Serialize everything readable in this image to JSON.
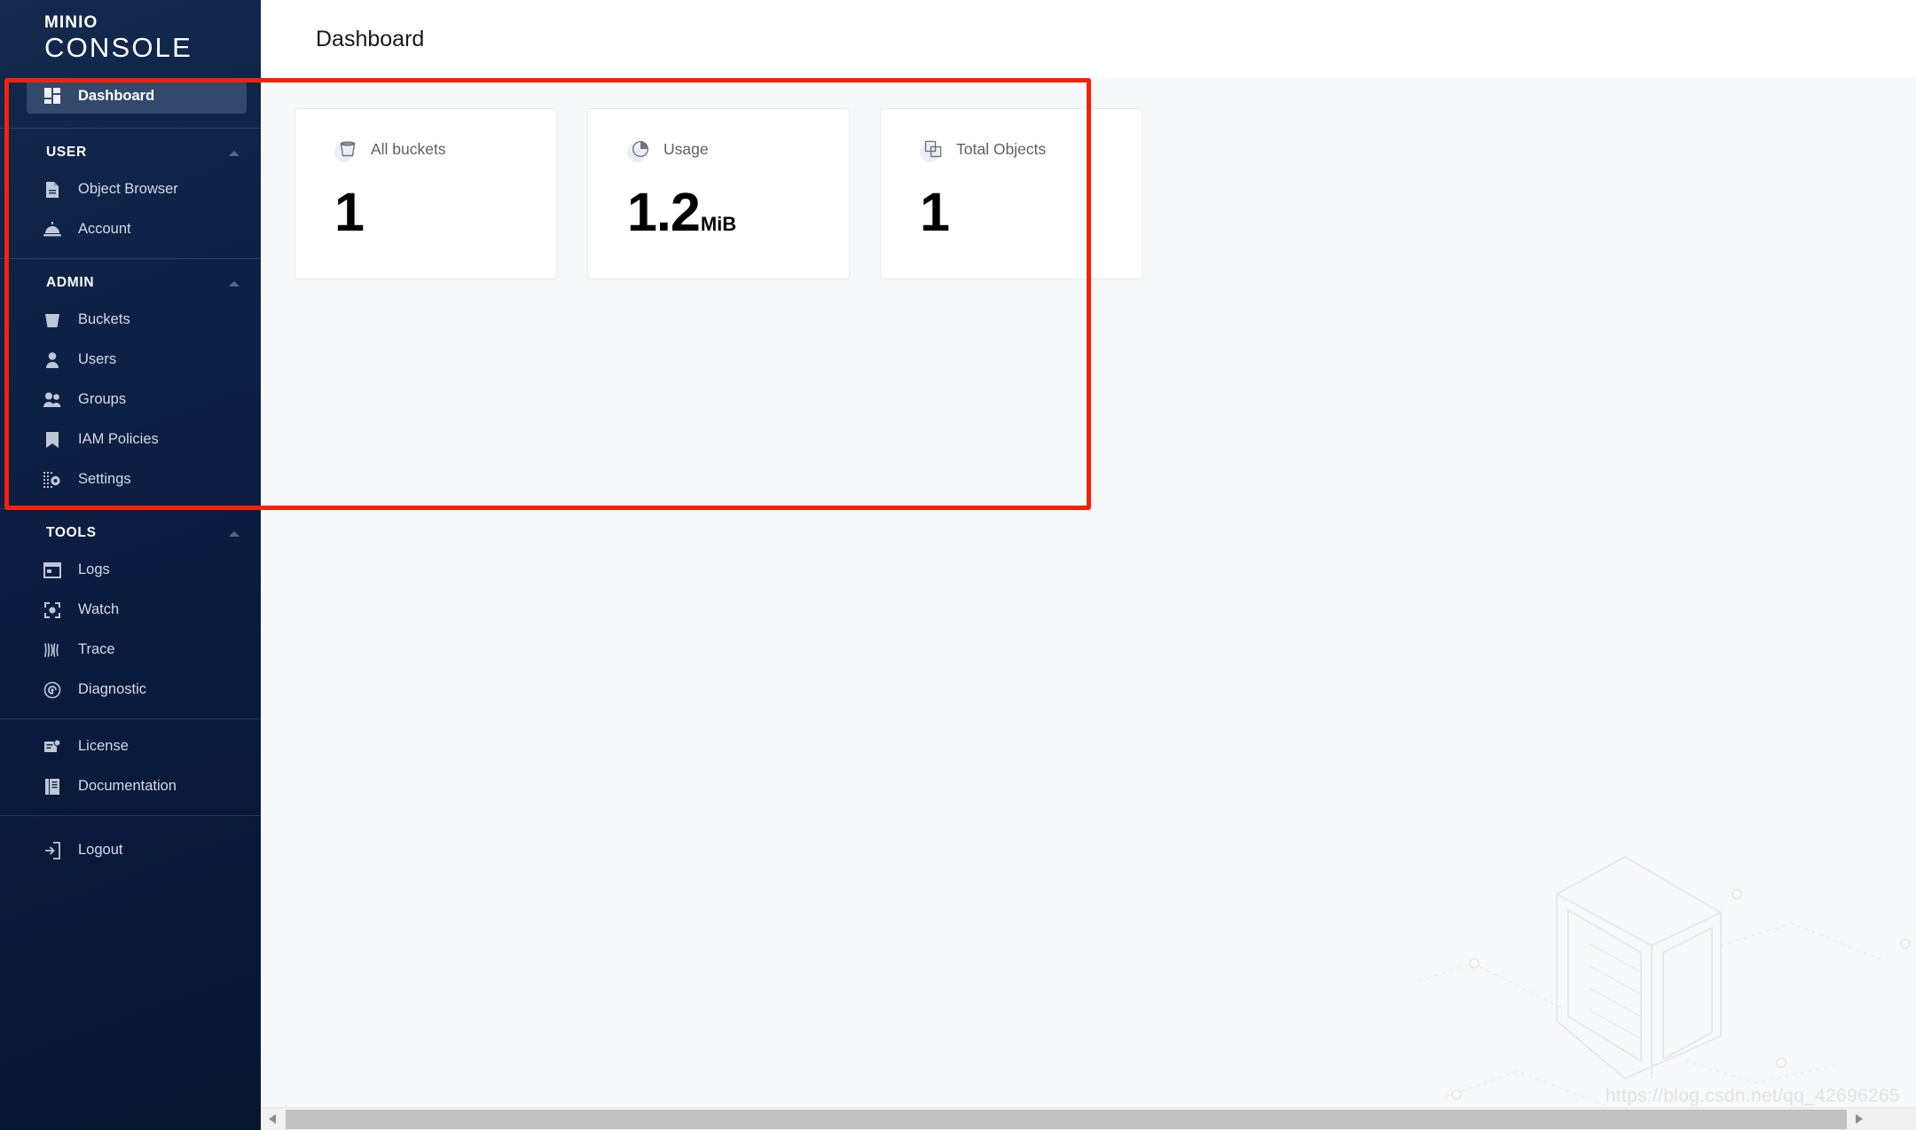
{
  "brand": {
    "logo_top": "MINIO",
    "logo_bottom": "CONSOLE"
  },
  "sidebar": {
    "primary": [
      {
        "label": "Dashboard",
        "icon": "dashboard-grid-icon",
        "active": true
      }
    ],
    "sections": [
      {
        "title": "USER",
        "collapse_icon": "chevron-up-icon",
        "items": [
          {
            "label": "Object Browser",
            "icon": "document-icon"
          },
          {
            "label": "Account",
            "icon": "service-bell-icon"
          }
        ]
      },
      {
        "title": "ADMIN",
        "collapse_icon": "chevron-up-icon",
        "items": [
          {
            "label": "Buckets",
            "icon": "bucket-icon"
          },
          {
            "label": "Users",
            "icon": "person-icon"
          },
          {
            "label": "Groups",
            "icon": "people-group-icon"
          },
          {
            "label": "IAM Policies",
            "icon": "bookmark-icon"
          },
          {
            "label": "Settings",
            "icon": "settings-gear-icon"
          }
        ]
      },
      {
        "title": "TOOLS",
        "collapse_icon": "chevron-up-icon",
        "items": [
          {
            "label": "Logs",
            "icon": "window-log-icon"
          },
          {
            "label": "Watch",
            "icon": "watch-target-icon"
          },
          {
            "label": "Trace",
            "icon": "trace-waves-icon"
          },
          {
            "label": "Diagnostic",
            "icon": "diagnostic-spiral-icon"
          }
        ]
      }
    ],
    "footer_items": [
      {
        "label": "License",
        "icon": "license-certificate-icon"
      },
      {
        "label": "Documentation",
        "icon": "book-icon"
      }
    ],
    "logout": {
      "label": "Logout",
      "icon": "logout-arrow-icon"
    }
  },
  "header": {
    "title": "Dashboard"
  },
  "cards": [
    {
      "title": "All buckets",
      "icon": "bucket-outline-icon",
      "value": "1",
      "unit": ""
    },
    {
      "title": "Usage",
      "icon": "pie-chart-icon",
      "value": "1.2",
      "unit": "MiB"
    },
    {
      "title": "Total Objects",
      "icon": "stacked-squares-icon",
      "value": "1",
      "unit": ""
    }
  ],
  "watermark": {
    "text": "https://blog.csdn.net/qq_42696265"
  },
  "annotation": {
    "shape": "rectangle",
    "color": "#f42209"
  },
  "colors": {
    "sidebar_dark": "#0d2147",
    "sidebar_active": "#32496c",
    "content_bg": "#f7f8f9",
    "card_bg": "#ffffff",
    "annotation_red": "#f42209"
  },
  "scrollbar": {
    "left_arrow_icon": "triangle-left-icon",
    "right_arrow_icon": "triangle-right-icon"
  }
}
